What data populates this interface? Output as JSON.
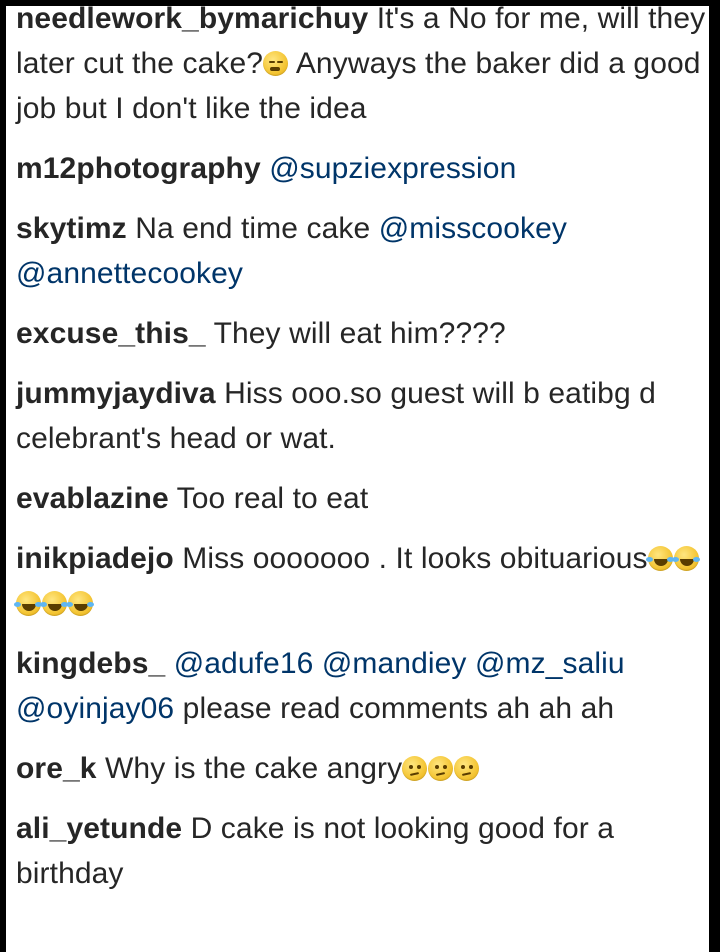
{
  "comments": [
    {
      "username": "needlework_bymarichuy",
      "segments": [
        {
          "type": "text",
          "value": "It's a No for me, will they later cut the cake?"
        },
        {
          "type": "emoji",
          "name": "persevering-face-icon"
        },
        {
          "type": "text",
          "value": " Anyways the baker did a good job but I don't like the idea"
        }
      ]
    },
    {
      "username": "m12photography",
      "segments": [
        {
          "type": "mention",
          "value": "@supziexpression"
        }
      ]
    },
    {
      "username": "skytimz",
      "segments": [
        {
          "type": "text",
          "value": "Na end time cake "
        },
        {
          "type": "mention",
          "value": "@misscookey"
        },
        {
          "type": "text",
          "value": " "
        },
        {
          "type": "mention",
          "value": "@annettecookey"
        }
      ]
    },
    {
      "username": "excuse_this_",
      "segments": [
        {
          "type": "text",
          "value": "They will eat him????"
        }
      ]
    },
    {
      "username": "jummyjaydiva",
      "segments": [
        {
          "type": "text",
          "value": "Hiss ooo.so guest will b eatibg d celebrant's head or wat."
        }
      ]
    },
    {
      "username": "evablazine",
      "segments": [
        {
          "type": "text",
          "value": "Too real to eat"
        }
      ]
    },
    {
      "username": "inikpiadejo",
      "segments": [
        {
          "type": "text",
          "value": "Miss ooooooo . It looks obituarious"
        },
        {
          "type": "emoji",
          "name": "tears-of-joy-icon"
        },
        {
          "type": "emoji",
          "name": "tears-of-joy-icon"
        },
        {
          "type": "emoji",
          "name": "tears-of-joy-icon"
        },
        {
          "type": "emoji",
          "name": "tears-of-joy-icon"
        },
        {
          "type": "emoji",
          "name": "tears-of-joy-icon"
        }
      ]
    },
    {
      "username": "kingdebs_",
      "segments": [
        {
          "type": "mention",
          "value": "@adufe16"
        },
        {
          "type": "text",
          "value": " "
        },
        {
          "type": "mention",
          "value": "@mandiey"
        },
        {
          "type": "text",
          "value": " "
        },
        {
          "type": "mention",
          "value": "@mz_saliu"
        },
        {
          "type": "text",
          "value": " "
        },
        {
          "type": "mention",
          "value": "@oyinjay06"
        },
        {
          "type": "text",
          "value": " please read comments ah ah ah"
        }
      ]
    },
    {
      "username": "ore_k",
      "segments": [
        {
          "type": "text",
          "value": "Why is the cake angry"
        },
        {
          "type": "emoji",
          "name": "confused-face-icon"
        },
        {
          "type": "emoji",
          "name": "confused-face-icon"
        },
        {
          "type": "emoji",
          "name": "confused-face-icon"
        }
      ]
    },
    {
      "username": "ali_yetunde",
      "segments": [
        {
          "type": "text",
          "value": "D cake is not looking good for a birthday"
        }
      ]
    }
  ],
  "colors": {
    "frame": "#000000",
    "background": "#ffffff",
    "text": "#262626",
    "mention": "#003569"
  }
}
